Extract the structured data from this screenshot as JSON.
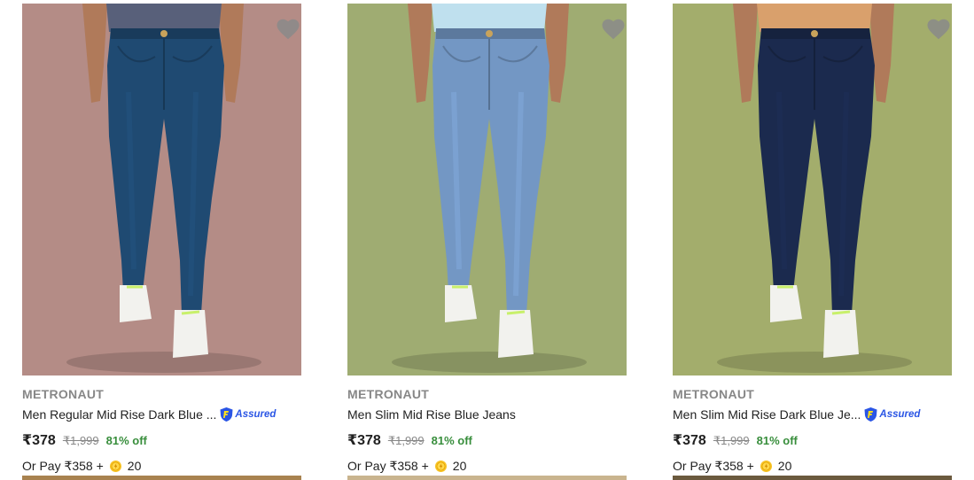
{
  "products": [
    {
      "brand": "METRONAUT",
      "title": "Men Regular Mid Rise Dark Blue ...",
      "assured": true,
      "assured_label": "Assured",
      "price": "₹378",
      "mrp": "₹1,999",
      "discount": "81% off",
      "pay_prefix": "Or Pay ₹358 +",
      "coins": "20",
      "bg_color": "#b48c86",
      "denim_color": "#1f4a72",
      "top_color": "#58607a"
    },
    {
      "brand": "METRONAUT",
      "title": "Men Slim Mid Rise Blue Jeans",
      "assured": false,
      "assured_label": "",
      "price": "₹378",
      "mrp": "₹1,999",
      "discount": "81% off",
      "pay_prefix": "Or Pay ₹358 +",
      "coins": "20",
      "bg_color": "#9fac72",
      "denim_color": "#7397c4",
      "top_color": "#bfe0ee"
    },
    {
      "brand": "METRONAUT",
      "title": "Men Slim Mid Rise Dark Blue Je...",
      "assured": true,
      "assured_label": "Assured",
      "price": "₹378",
      "mrp": "₹1,999",
      "discount": "81% off",
      "pay_prefix": "Or Pay ₹358 +",
      "coins": "20",
      "bg_color": "#a3ad6c",
      "denim_color": "#1b2a4e",
      "top_color": "#d9a06c"
    }
  ],
  "colors": {
    "discount": "#388e3c",
    "assured_blue": "#2a55e5",
    "wishlist": "#8a8a8a"
  },
  "icons": {
    "wishlist": "heart-icon",
    "assured": "flipkart-assured-badge",
    "coin": "supercoin-icon"
  }
}
